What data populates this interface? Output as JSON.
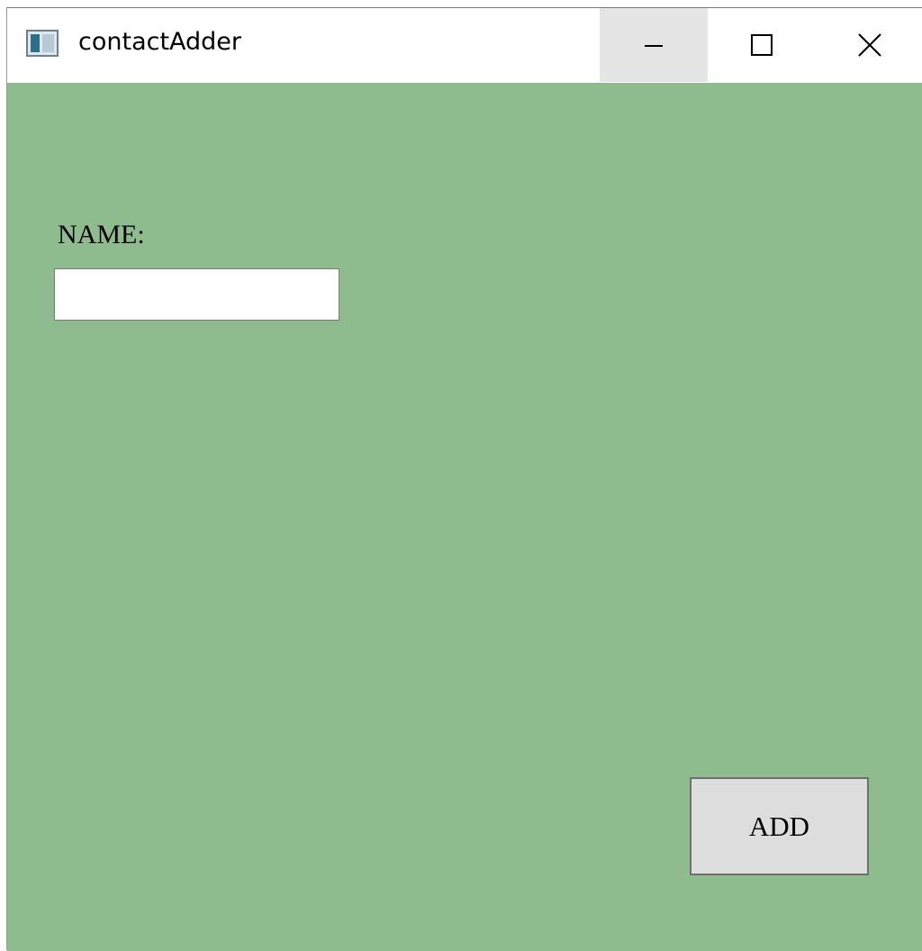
{
  "window": {
    "title": "contactAdder",
    "icon": "app-window-icon",
    "controls": {
      "minimize_icon": "minimize-icon",
      "maximize_icon": "maximize-icon",
      "close_icon": "close-icon"
    }
  },
  "form": {
    "background_color": "#8fbc8f",
    "name_label": "NAME:",
    "name_value": "",
    "add_button_label": "ADD"
  }
}
